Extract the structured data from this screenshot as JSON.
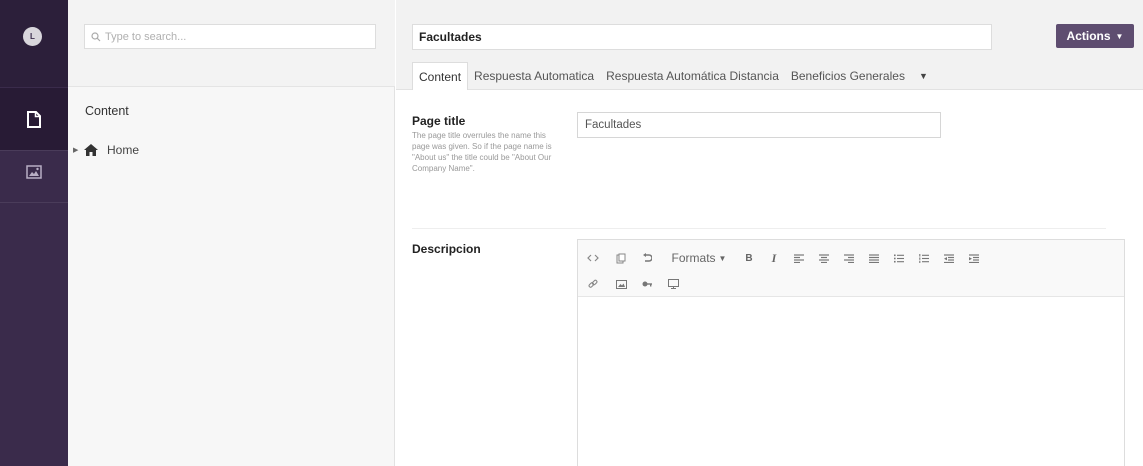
{
  "app": {
    "avatar_initial": "L",
    "sections": [
      {
        "icon": "document-icon",
        "active": true
      },
      {
        "icon": "media-icon",
        "active": false
      }
    ]
  },
  "tree": {
    "search": {
      "placeholder": "Type to search..."
    },
    "heading": "Content",
    "items": [
      {
        "label": "Home",
        "icon": "home-icon"
      }
    ]
  },
  "editor": {
    "node_name": "Facultades",
    "actions_label": "Actions",
    "tabs": [
      {
        "label": "Content",
        "active": true
      },
      {
        "label": "Respuesta Automatica",
        "active": false
      },
      {
        "label": "Respuesta Automática Distancia",
        "active": false
      },
      {
        "label": "Beneficios Generales",
        "active": false
      }
    ],
    "properties": {
      "page_title": {
        "label": "Page title",
        "description": "The page title overrules the name this page was given. So if the page name is \"About us\" the title could be \"About Our Company Name\".",
        "value": "Facultades"
      },
      "descripcion": {
        "label": "Descripcion"
      }
    },
    "rte_toolbar": {
      "formats_label": "Formats",
      "bold_label": "B",
      "italic_label": "I"
    }
  },
  "colors": {
    "appbar": "#3a2b4b",
    "appbar_top": "#2c1f3a",
    "actions_button": "#5e4d70"
  }
}
